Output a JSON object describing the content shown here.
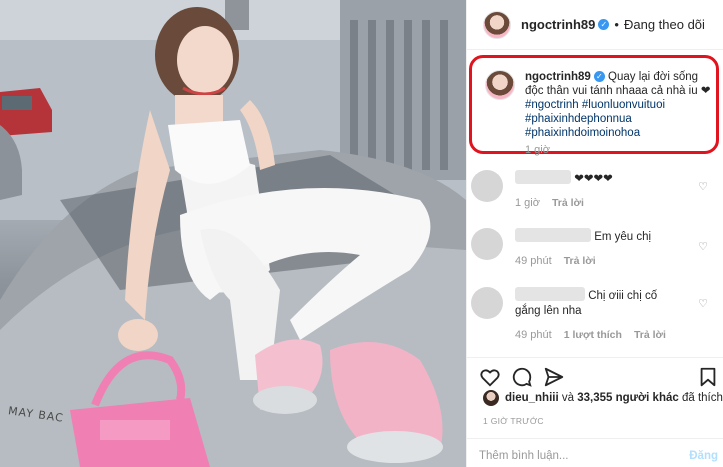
{
  "post": {
    "photo_brand": "MAY BAC",
    "photo_alt": "photo-post"
  },
  "header": {
    "username": "ngoctrinh89",
    "separator": "•",
    "follow_status": "Đang theo dõi"
  },
  "caption": {
    "username": "ngoctrinh89",
    "text": "Quay lại đời sống độc thân vui tánh nhaaa cả nhà iu ❤︎",
    "hashtags": [
      "#ngoctrinh #luonluonvuituoi",
      "#phaixinhdephonnua",
      "#phaixinhdoimoinohoa"
    ],
    "time": "1 giờ"
  },
  "comments": [
    {
      "text": "❤❤❤❤",
      "time": "1 giờ",
      "reply": "Trả lời",
      "likes": ""
    },
    {
      "text": "Em yêu chị",
      "time": "49 phút",
      "reply": "Trả lời",
      "likes": ""
    },
    {
      "text": "Chị ơiii chị cố gắng lên nha",
      "time": "49 phút",
      "reply": "Trả lời",
      "likes": "1 lượt thích"
    }
  ],
  "likes": {
    "user": "dieu_nhiii",
    "connector": "và",
    "others": "33,355 người khác",
    "suffix": "đã thích"
  },
  "time_ago": "1 GIỜ TRƯỚC",
  "add_comment": {
    "placeholder": "Thêm bình luận...",
    "post_label": "Đăng"
  },
  "colors": {
    "highlight_box": "#e0141e",
    "hashtag": "#003569",
    "verified": "#3897f0",
    "post_disabled": "#b2dffc"
  },
  "icons": [
    "verified-icon",
    "heart-icon",
    "comment-icon",
    "share-icon",
    "bookmark-icon",
    "small-heart-icon"
  ]
}
